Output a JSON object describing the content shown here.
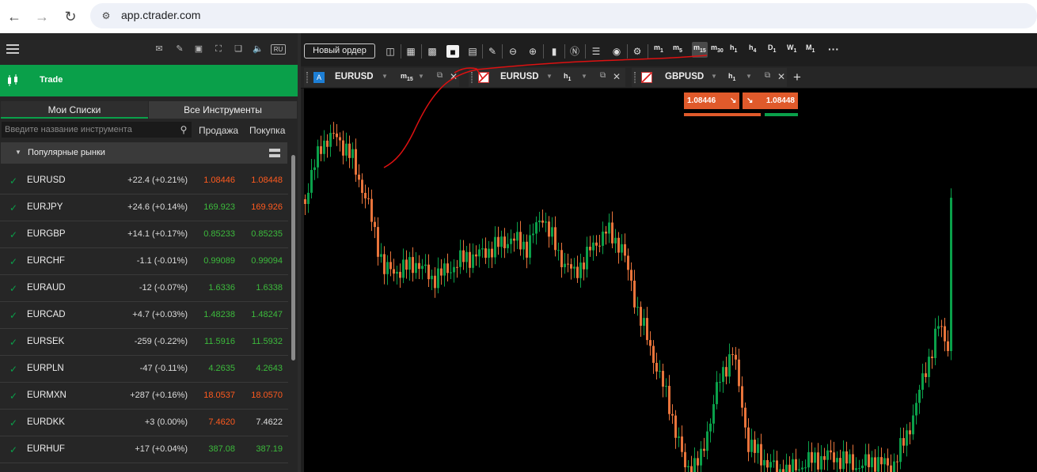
{
  "browser": {
    "url": "app.ctrader.com"
  },
  "sidebar": {
    "trade_label": "Trade",
    "lang": "RU",
    "tabs": {
      "my_lists": "Мои Списки",
      "all_instruments": "Все Инструменты"
    },
    "search_placeholder": "Введите название инструмента",
    "col_sell": "Продажа",
    "col_buy": "Покупка",
    "group_label": "Популярные рынки",
    "colors": {
      "accent": "#0aa04a",
      "sell_down": "#ff5a1f",
      "up": "#3cba3c"
    },
    "rows": [
      {
        "symbol": "EURUSD",
        "change": "+22.4 (+0.21%)",
        "sell": "1.08446",
        "buy": "1.08448",
        "sell_color": "#ff5a1f",
        "buy_color": "#ff5a1f"
      },
      {
        "symbol": "EURJPY",
        "change": "+24.6 (+0.14%)",
        "sell": "169.923",
        "buy": "169.926",
        "sell_color": "#3cba3c",
        "buy_color": "#ff5a1f"
      },
      {
        "symbol": "EURGBP",
        "change": "+14.1 (+0.17%)",
        "sell": "0.85233",
        "buy": "0.85235",
        "sell_color": "#3cba3c",
        "buy_color": "#3cba3c"
      },
      {
        "symbol": "EURCHF",
        "change": "-1.1 (-0.01%)",
        "sell": "0.99089",
        "buy": "0.99094",
        "sell_color": "#3cba3c",
        "buy_color": "#3cba3c"
      },
      {
        "symbol": "EURAUD",
        "change": "-12 (-0.07%)",
        "sell": "1.6336",
        "buy": "1.6338",
        "sell_color": "#3cba3c",
        "buy_color": "#3cba3c"
      },
      {
        "symbol": "EURCAD",
        "change": "+4.7 (+0.03%)",
        "sell": "1.48238",
        "buy": "1.48247",
        "sell_color": "#3cba3c",
        "buy_color": "#3cba3c"
      },
      {
        "symbol": "EURSEK",
        "change": "-259 (-0.22%)",
        "sell": "11.5916",
        "buy": "11.5932",
        "sell_color": "#3cba3c",
        "buy_color": "#3cba3c"
      },
      {
        "symbol": "EURPLN",
        "change": "-47 (-0.11%)",
        "sell": "4.2635",
        "buy": "4.2643",
        "sell_color": "#3cba3c",
        "buy_color": "#3cba3c"
      },
      {
        "symbol": "EURMXN",
        "change": "+287 (+0.16%)",
        "sell": "18.0537",
        "buy": "18.0570",
        "sell_color": "#ff5a1f",
        "buy_color": "#ff5a1f"
      },
      {
        "symbol": "EURDKK",
        "change": "+3 (0.00%)",
        "sell": "7.4620",
        "buy": "7.4622",
        "sell_color": "#ff5a1f",
        "buy_color": "#dddddd"
      },
      {
        "symbol": "EURHUF",
        "change": "+17 (+0.04%)",
        "sell": "387.08",
        "buy": "387.19",
        "sell_color": "#3cba3c",
        "buy_color": "#3cba3c"
      }
    ]
  },
  "toolbar": {
    "new_order": "Новый ордер",
    "timeframes": [
      {
        "base": "m",
        "sub": "1"
      },
      {
        "base": "m",
        "sub": "5"
      },
      {
        "base": "m",
        "sub": "15",
        "selected": true
      },
      {
        "base": "m",
        "sub": "30"
      },
      {
        "base": "h",
        "sub": "1"
      },
      {
        "base": "h",
        "sub": "4"
      },
      {
        "base": "D",
        "sub": "1"
      },
      {
        "base": "W",
        "sub": "1"
      },
      {
        "base": "M",
        "sub": "1"
      }
    ],
    "icons": [
      "screen-icon",
      "layout-icon",
      "grid-four-icon",
      "single-pane-icon",
      "split-pane-icon",
      "chart-edit-icon",
      "zoom-out-icon",
      "zoom-in-icon",
      "candles-icon",
      "f-icon",
      "layers-icon",
      "eye-icon",
      "settings-chart-icon"
    ]
  },
  "chart_tabs": [
    {
      "badge": "A",
      "symbol": "EURUSD",
      "tf_base": "m",
      "tf_sub": "15"
    },
    {
      "badge": "",
      "symbol": "EURUSD",
      "tf_base": "h",
      "tf_sub": "1"
    },
    {
      "badge": "",
      "symbol": "GBPUSD",
      "tf_base": "h",
      "tf_sub": "1"
    }
  ],
  "quote": {
    "sell": "1.08446",
    "buy": "1.08448"
  },
  "chart_data": {
    "type": "candlestick",
    "symbol": "EURUSD",
    "up_color": "#0aa04a",
    "down_color": "#e8743b"
  }
}
